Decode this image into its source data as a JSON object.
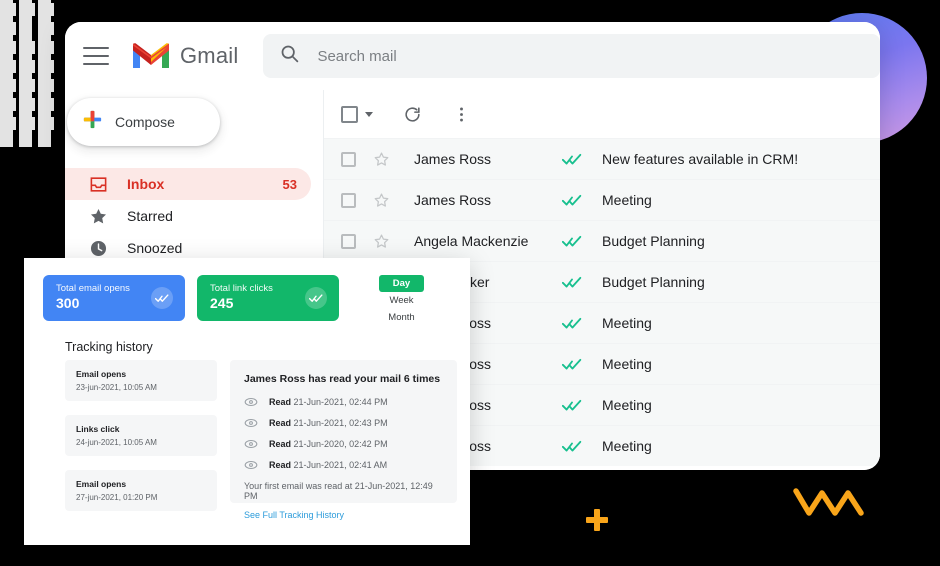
{
  "decor": {
    "grid_icon": "checker-grid-pattern",
    "circle_icon": "gradient-circle",
    "plus_icon": "plus-sparkle",
    "squiggle_icon": "orange-squiggle",
    "colors": {
      "gradient_start": "#5b7bf0",
      "gradient_end": "#cf9ae3",
      "accent_orange": "#f9a51a"
    }
  },
  "gmail": {
    "header": {
      "menu_icon": "hamburger-menu-icon",
      "logo_icon": "gmail-logo-icon",
      "wordmark": "Gmail",
      "search": {
        "icon": "search-icon",
        "placeholder": "Search mail",
        "value": ""
      }
    },
    "sidebar": {
      "compose": {
        "label": "Compose",
        "icon": "compose-plus-icon"
      },
      "items": [
        {
          "label": "Inbox",
          "icon": "inbox-icon",
          "count": "53",
          "active": true
        },
        {
          "label": "Starred",
          "icon": "star-icon",
          "count": "",
          "active": false
        },
        {
          "label": "Snoozed",
          "icon": "clock-icon",
          "count": "",
          "active": false
        }
      ]
    },
    "toolbar": {
      "select_all_icon": "checkbox-icon",
      "select_caret_icon": "chevron-down-icon",
      "refresh_icon": "refresh-icon",
      "more_icon": "more-vertical-icon"
    },
    "list": {
      "rows": [
        {
          "sender": "James Ross",
          "subject": "New features available in CRM!"
        },
        {
          "sender": "James Ross",
          "subject": "Meeting"
        },
        {
          "sender": "Angela Mackenzie",
          "subject": "Budget Planning"
        },
        {
          "sender": "Alice Parker",
          "subject": "Budget Planning"
        },
        {
          "sender": "James Ross",
          "subject": "Meeting"
        },
        {
          "sender": "James Ross",
          "subject": "Meeting"
        },
        {
          "sender": "James Ross",
          "subject": "Meeting"
        },
        {
          "sender": "James Ross",
          "subject": "Meeting"
        }
      ],
      "row_icons": {
        "checkbox_icon": "checkbox-icon",
        "star_icon": "star-outline-icon",
        "tracked_icon": "double-check-icon"
      }
    }
  },
  "tracking": {
    "stats": [
      {
        "label": "Total email opens",
        "value": "300",
        "color": "#4285f4",
        "icon": "double-check-icon"
      },
      {
        "label": "Total link clicks",
        "value": "245",
        "color": "#12b76a",
        "icon": "double-check-icon"
      }
    ],
    "range": {
      "options": [
        {
          "label": "Day",
          "active": true
        },
        {
          "label": "Week",
          "active": false
        },
        {
          "label": "Month",
          "active": false
        }
      ]
    },
    "history_title": "Tracking history",
    "history": [
      {
        "title": "Email opens",
        "time": "23-jun-2021, 10:05 AM"
      },
      {
        "title": "Links click",
        "time": "24-jun-2021, 10:05 AM"
      },
      {
        "title": "Email opens",
        "time": "27-jun-2021, 01:20 PM"
      }
    ],
    "detail": {
      "headline": "James Ross has read your mail 6 times",
      "reads": [
        {
          "label": "Read",
          "time": "21-Jun-2021, 02:44 PM",
          "icon": "eye-icon"
        },
        {
          "label": "Read",
          "time": "21-Jun-2021, 02:43 PM",
          "icon": "eye-icon"
        },
        {
          "label": "Read",
          "time": "21-Jun-2020, 02:42 PM",
          "icon": "eye-icon"
        },
        {
          "label": "Read",
          "time": "21-Jun-2021, 02:41 AM",
          "icon": "eye-icon"
        }
      ],
      "first_read": "Your first email was read at 21-Jun-2021, 12:49 PM",
      "link": "See Full Tracking History"
    }
  }
}
